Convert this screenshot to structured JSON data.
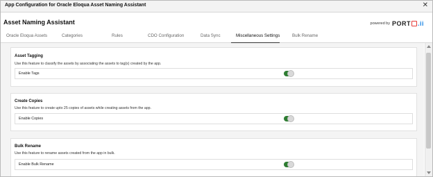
{
  "window": {
    "title": "App Configuration for Oracle Eloqua Asset Naming Assistant"
  },
  "header": {
    "app_name": "Asset Naming Assistant",
    "powered_by": "powered by",
    "logo_text_1": "PORT",
    "logo_text_2": ".ii"
  },
  "tabs": [
    {
      "label": "Oracle Eloqua Assets"
    },
    {
      "label": "Categories"
    },
    {
      "label": "Rules"
    },
    {
      "label": "CDO Configuration"
    },
    {
      "label": "Data Sync"
    },
    {
      "label": "Miscellaneous Settings",
      "active": true
    },
    {
      "label": "Bulk Rename"
    }
  ],
  "sections": [
    {
      "title": "Asset Tagging",
      "description": "Use this feature to classify the assets by associating the assets to tag(s) created by the app.",
      "setting_label": "Enable Tags",
      "enabled": true
    },
    {
      "title": "Create Copies",
      "description": "Use this feature to create upto 25 copies of assets while creating assets from the app.",
      "setting_label": "Enable Copies",
      "enabled": true
    },
    {
      "title": "Bulk Rename",
      "description": "Use this feature to rename assets created from the app in bulk.",
      "setting_label": "Enable Bulk Rename",
      "enabled": true
    }
  ],
  "colors": {
    "toggle_on": "#2e7d32",
    "logo_accent": "#e53935"
  },
  "icons": {
    "close": "close-icon"
  }
}
